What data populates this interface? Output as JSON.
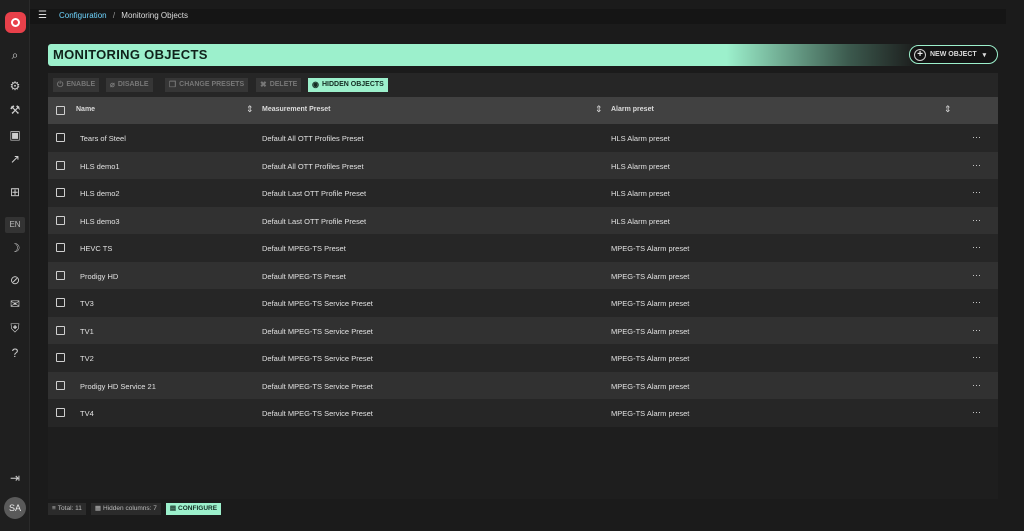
{
  "app": {
    "logo": "app-logo"
  },
  "sidebar": {
    "icons": [
      "search-icon",
      "settings-icon",
      "wrench-icon",
      "monitor-icon",
      "chart-icon",
      "dashboard-icon",
      "moon-icon",
      "mute-icon",
      "mail-off-icon",
      "shield-icon",
      "help-icon"
    ],
    "lang": "EN",
    "user_initials": "SA"
  },
  "breadcrumb": {
    "parent": "Configuration",
    "separator": "/",
    "current": "Monitoring Objects"
  },
  "header": {
    "title": "MONITORING OBJECTS",
    "new_button": "NEW OBJECT"
  },
  "toolbar": {
    "enable": "ENABLE",
    "disable": "DISABLE",
    "change_presets": "CHANGE PRESETS",
    "delete": "DELETE",
    "hidden_objects": "HIDDEN OBJECTS"
  },
  "table": {
    "columns": {
      "name": "Name",
      "measurement": "Measurement Preset",
      "alarm": "Alarm preset"
    },
    "rows": [
      {
        "name": "Tears of Steel",
        "measurement": "Default All OTT Profiles Preset",
        "alarm": "HLS Alarm preset"
      },
      {
        "name": "HLS demo1",
        "measurement": "Default All OTT Profiles Preset",
        "alarm": "HLS Alarm preset"
      },
      {
        "name": "HLS demo2",
        "measurement": "Default Last OTT Profile Preset",
        "alarm": "HLS Alarm preset"
      },
      {
        "name": "HLS demo3",
        "measurement": "Default Last OTT Profile Preset",
        "alarm": "HLS Alarm preset"
      },
      {
        "name": "HEVC TS",
        "measurement": "Default MPEG-TS Preset",
        "alarm": "MPEG-TS Alarm preset"
      },
      {
        "name": "Prodigy HD",
        "measurement": "Default MPEG-TS Preset",
        "alarm": "MPEG-TS Alarm preset"
      },
      {
        "name": "TV3",
        "measurement": "Default MPEG-TS Service Preset",
        "alarm": "MPEG-TS Alarm preset"
      },
      {
        "name": "TV1",
        "measurement": "Default MPEG-TS Service Preset",
        "alarm": "MPEG-TS Alarm preset"
      },
      {
        "name": "TV2",
        "measurement": "Default MPEG-TS Service Preset",
        "alarm": "MPEG-TS Alarm preset"
      },
      {
        "name": "Prodigy HD Service 21",
        "measurement": "Default MPEG-TS Service Preset",
        "alarm": "MPEG-TS Alarm preset"
      },
      {
        "name": "TV4",
        "measurement": "Default MPEG-TS Service Preset",
        "alarm": "MPEG-TS Alarm preset"
      }
    ]
  },
  "footer": {
    "total": "Total: 11",
    "hidden_columns": "Hidden columns: 7",
    "configure": "CONFIGURE"
  },
  "colors": {
    "accent": "#9cf0cc",
    "logo": "#e8404a",
    "link": "#6fd5ff"
  }
}
